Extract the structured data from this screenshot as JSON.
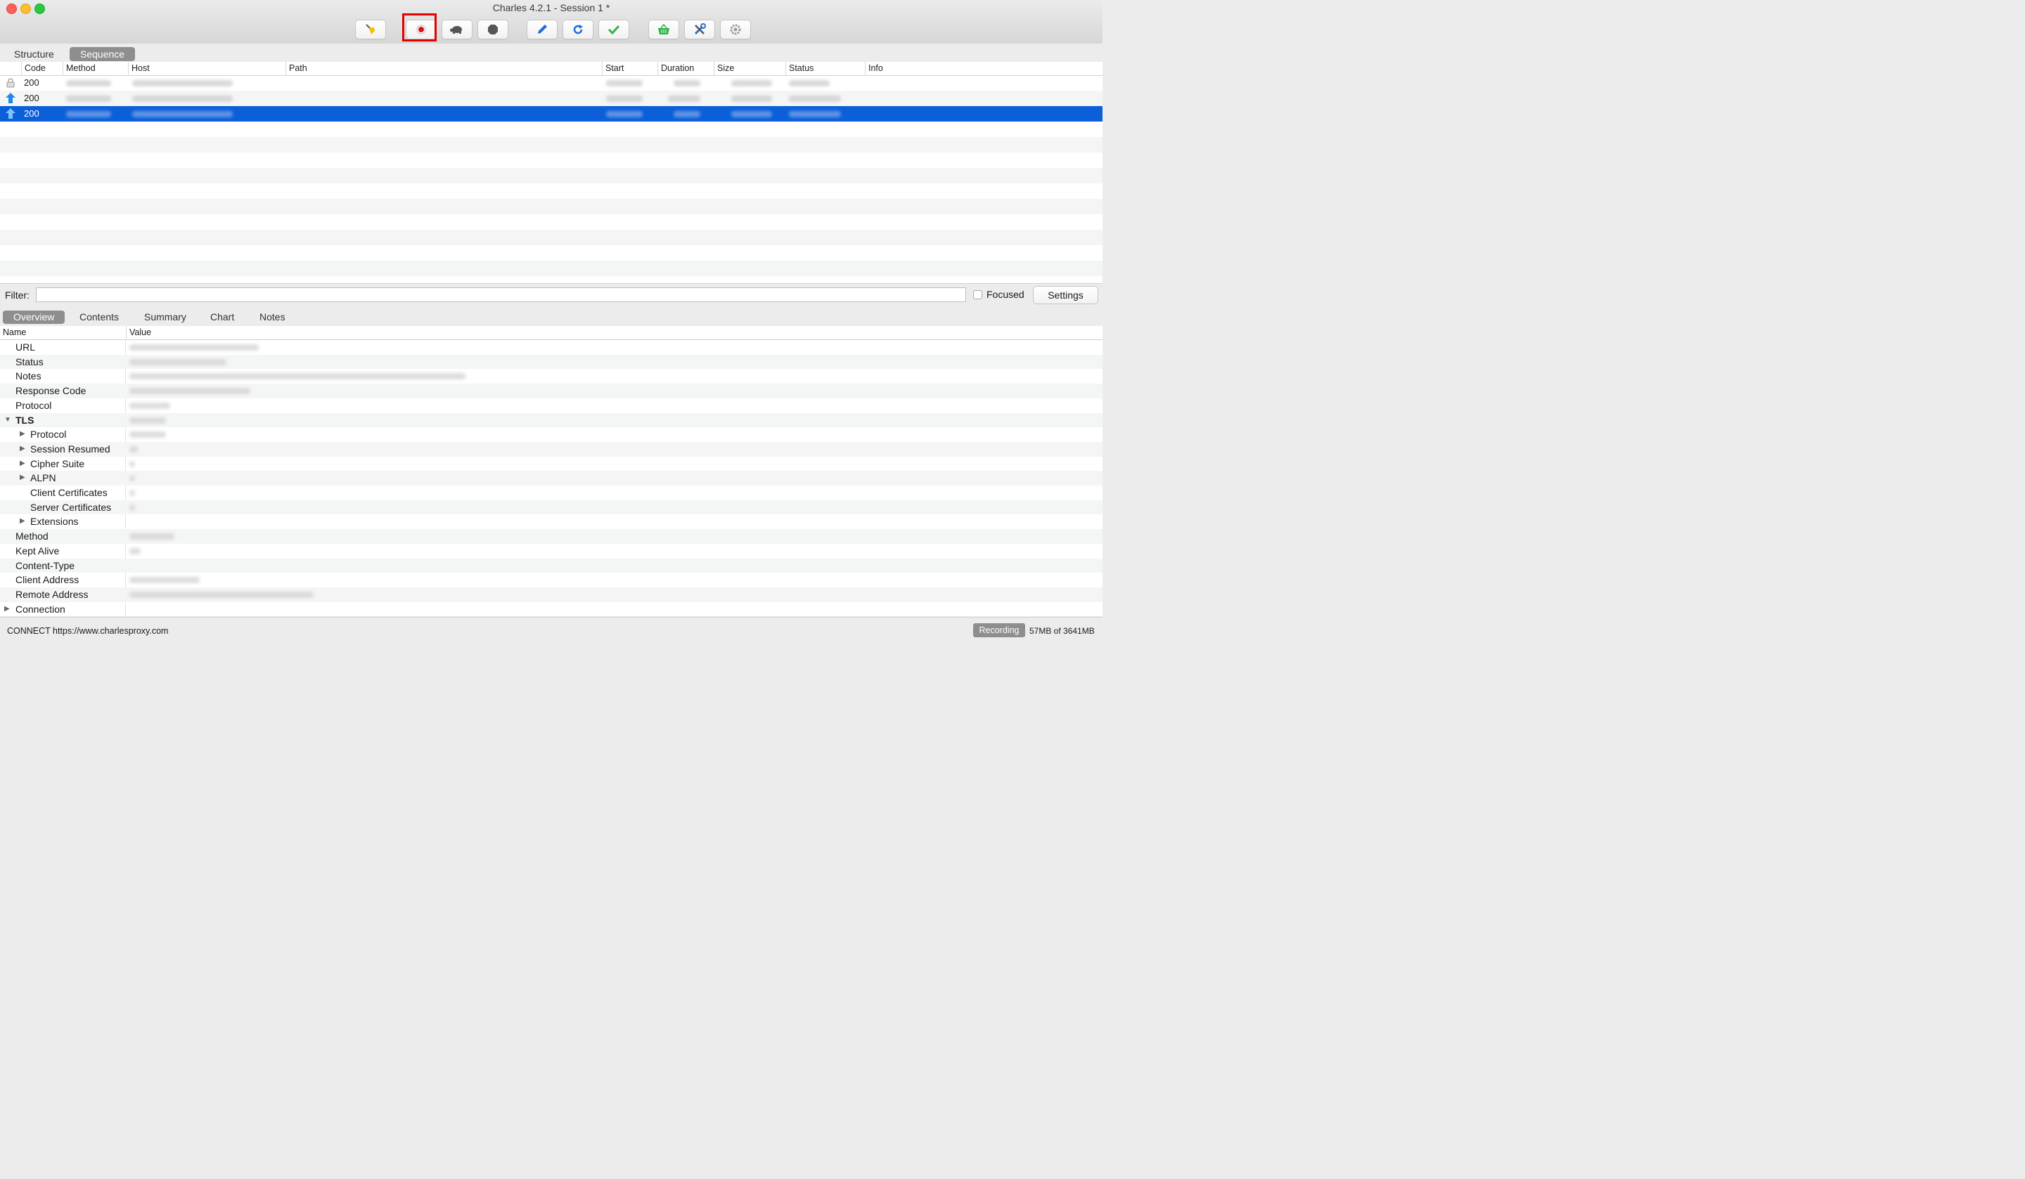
{
  "window": {
    "title": "Charles 4.2.1 - Session 1 *"
  },
  "toolbar": {
    "buttons": [
      "broom-icon",
      "record-icon",
      "turtle-icon",
      "stop-icon",
      "pen-icon",
      "refresh-icon",
      "checkmark-icon",
      "basket-icon",
      "tools-icon",
      "gear-icon"
    ],
    "highlighted": "record-icon",
    "highlight_color": "#e30000",
    "record_color": "#e0101a"
  },
  "view_tabs": [
    "Structure",
    "Sequence"
  ],
  "active_view_tab": "Sequence",
  "table": {
    "columns": [
      "Code",
      "Method",
      "Host",
      "Path",
      "Start",
      "Duration",
      "Size",
      "Status",
      "Info"
    ],
    "rows": [
      {
        "icon": "lock-icon",
        "code": "200",
        "selected": false
      },
      {
        "icon": "upload-arrow-icon",
        "code": "200",
        "selected": false
      },
      {
        "icon": "upload-arrow-icon",
        "code": "200",
        "selected": true
      }
    ],
    "selection_color": "#0b5fd9"
  },
  "filter": {
    "label": "Filter:",
    "value": "",
    "focused_label": "Focused",
    "settings_label": "Settings"
  },
  "detail_tabs": [
    "Overview",
    "Contents",
    "Summary",
    "Chart",
    "Notes"
  ],
  "active_detail_tab": "Overview",
  "overview": {
    "columns": [
      "Name",
      "Value"
    ],
    "rows": [
      {
        "name": "URL",
        "expander": ""
      },
      {
        "name": "Status",
        "expander": ""
      },
      {
        "name": "Notes",
        "expander": ""
      },
      {
        "name": "Response Code",
        "expander": ""
      },
      {
        "name": "Protocol",
        "expander": ""
      },
      {
        "name": "TLS",
        "expander": "expanded"
      },
      {
        "name": "Protocol",
        "expander": "collapsed"
      },
      {
        "name": "Session Resumed",
        "expander": "collapsed"
      },
      {
        "name": "Cipher Suite",
        "expander": "collapsed"
      },
      {
        "name": "ALPN",
        "expander": "collapsed"
      },
      {
        "name": "Client Certificates",
        "expander": ""
      },
      {
        "name": "Server Certificates",
        "expander": ""
      },
      {
        "name": "Extensions",
        "expander": "collapsed"
      },
      {
        "name": "Method",
        "expander": ""
      },
      {
        "name": "Kept Alive",
        "expander": ""
      },
      {
        "name": "Content-Type",
        "expander": ""
      },
      {
        "name": "Client Address",
        "expander": ""
      },
      {
        "name": "Remote Address",
        "expander": ""
      },
      {
        "name": "Connection",
        "expander": "collapsed"
      }
    ]
  },
  "statusbar": {
    "text": "CONNECT https://www.charlesproxy.com",
    "recording_label": "Recording",
    "memory": "57MB of 3641MB"
  }
}
